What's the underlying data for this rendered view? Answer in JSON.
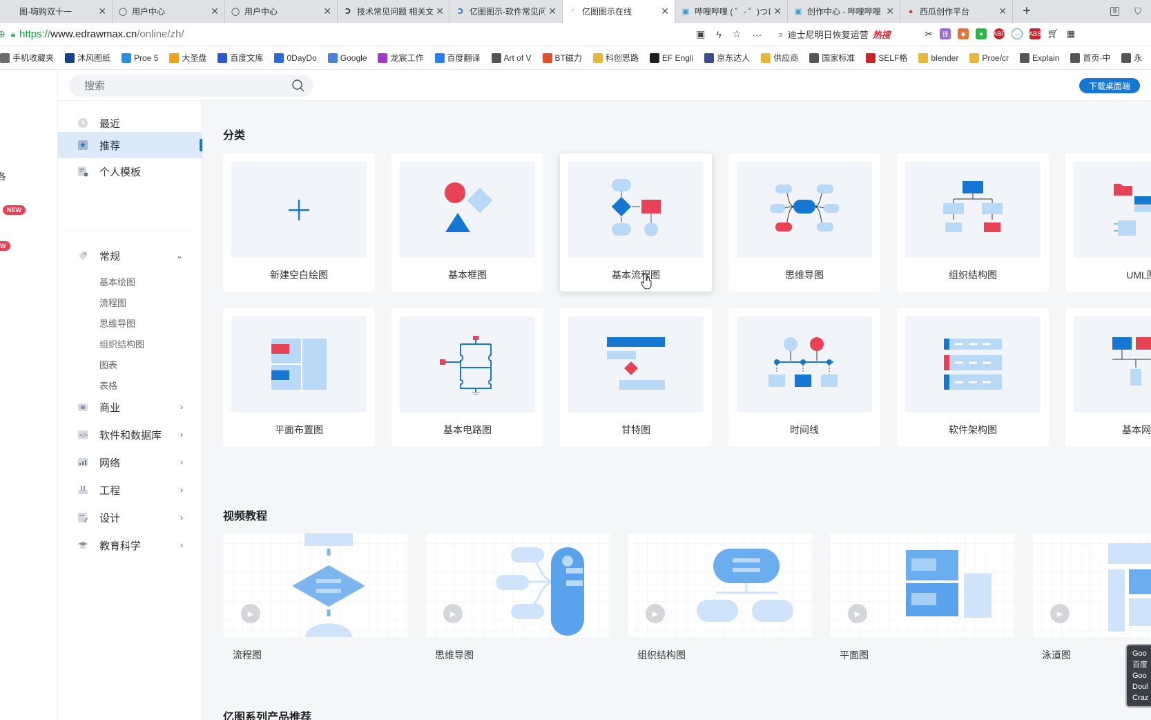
{
  "browser": {
    "tabs": [
      {
        "title": "图-嗨购双十一",
        "icon": "page-icon",
        "active": false
      },
      {
        "title": "用户中心",
        "icon": "user-icon",
        "active": false
      },
      {
        "title": "用户中心",
        "icon": "user-icon",
        "active": false
      },
      {
        "title": "技术常见问题 相关文",
        "icon": "d-logo-icon",
        "active": false
      },
      {
        "title": "亿图图示-软件常见问",
        "icon": "edraw-icon",
        "active": false
      },
      {
        "title": "亿图图示在线",
        "icon": "loading-icon",
        "active": true
      },
      {
        "title": "哔哩哔哩 ( ゜- ゜)つロ",
        "icon": "bilibili-icon",
        "active": false
      },
      {
        "title": "创作中心 - 哔哩哔哩",
        "icon": "bilibili-icon",
        "active": false
      },
      {
        "title": "西瓜创作平台",
        "icon": "xigua-icon",
        "active": false
      }
    ],
    "window_count": "9",
    "url_scheme": "https://",
    "url_host": "www.edrawmax.cn",
    "url_path": "/online/zh/",
    "search_text": "迪士尼明日恢复运营",
    "hot_label": "热搜",
    "bookmarks": [
      {
        "label": "手机收藏夹",
        "color": "#6a6a6a"
      },
      {
        "label": "沐风图纸",
        "color": "#1b3f8b"
      },
      {
        "label": "Proe 5",
        "color": "#2b8ee3"
      },
      {
        "label": "大圣盘",
        "color": "#f0a21b"
      },
      {
        "label": "百度文库",
        "color": "#2a58d8"
      },
      {
        "label": "0DayDo",
        "color": "#2a6bd8"
      },
      {
        "label": "Google",
        "color": "#4a7fe0"
      },
      {
        "label": "龙宸工作",
        "color": "#a03ac8"
      },
      {
        "label": "百度翻译",
        "color": "#2a7ff0"
      },
      {
        "label": "Art of V",
        "color": "#555"
      },
      {
        "label": "BT磁力",
        "color": "#e0512a"
      },
      {
        "label": "科创思路",
        "color": "#e6b73a"
      },
      {
        "label": "EF Engli",
        "color": "#1e1e1e"
      },
      {
        "label": "京东达人",
        "color": "#3a4c8a"
      },
      {
        "label": "供应商",
        "color": "#e6b73a"
      },
      {
        "label": "国家标准",
        "color": "#555"
      },
      {
        "label": "SELF格",
        "color": "#c8252b"
      },
      {
        "label": "blender",
        "color": "#e6b73a"
      },
      {
        "label": "Proe/cr",
        "color": "#e6b73a"
      },
      {
        "label": "Explain",
        "color": "#555"
      },
      {
        "label": "首页-中",
        "color": "#555"
      },
      {
        "label": "永",
        "color": "#555"
      }
    ]
  },
  "app": {
    "search_placeholder": "搜索",
    "download_label": "下载桌面端",
    "left_badge_1": "NEW",
    "left_badge_2": "W",
    "left_char": "各"
  },
  "sidebar": {
    "items": [
      {
        "label": "最近",
        "icon": "clock-icon"
      },
      {
        "label": "推荐",
        "icon": "star-icon",
        "active": true
      },
      {
        "label": "个人模板",
        "icon": "template-icon"
      }
    ],
    "general": {
      "label": "常规",
      "icon": "tag-icon"
    },
    "sub_items": [
      "基本绘图",
      "流程图",
      "思维导图",
      "组织结构图",
      "图表",
      "表格"
    ],
    "groups": [
      {
        "label": "商业",
        "icon": "business-icon"
      },
      {
        "label": "软件和数据库",
        "icon": "code-icon"
      },
      {
        "label": "网络",
        "icon": "network-icon"
      },
      {
        "label": "工程",
        "icon": "engineering-icon"
      },
      {
        "label": "设计",
        "icon": "design-icon"
      },
      {
        "label": "教育科学",
        "icon": "education-icon"
      }
    ]
  },
  "main": {
    "category_title": "分类",
    "categories": [
      "新建空白绘图",
      "基本框图",
      "基本流程图",
      "思维导图",
      "组织结构图",
      "UML图",
      "平面布置图",
      "基本电路图",
      "甘特图",
      "时间线",
      "软件架构图",
      "基本网络"
    ],
    "video_title": "视频教程",
    "videos": [
      "流程图",
      "思维导图",
      "组织结构图",
      "平面图",
      "泳道图"
    ],
    "product_title": "亿图系列产品推荐"
  },
  "tooltip_lines": [
    "Goo",
    "百度",
    "Goo",
    "Doul",
    "Craz"
  ],
  "colors": {
    "accent": "#1677d2",
    "red": "#e84256",
    "light_blue": "#b9d9f7",
    "mid_blue": "#3b8ee8"
  }
}
